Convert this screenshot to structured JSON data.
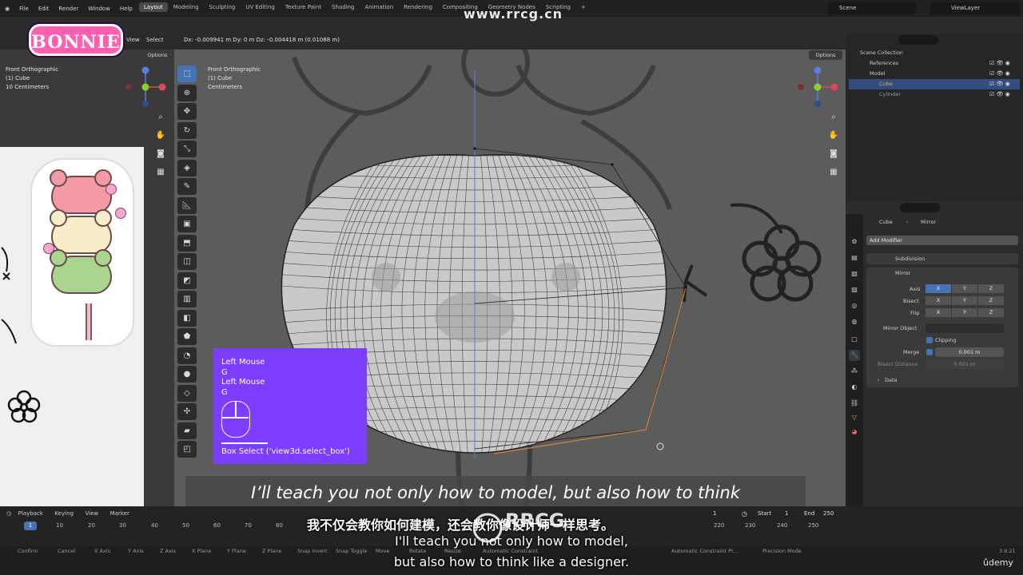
{
  "menubar": {
    "items": [
      "File",
      "Edit",
      "Render",
      "Window",
      "Help"
    ],
    "workspaces": [
      "Layout",
      "Modeling",
      "Sculpting",
      "UV Editing",
      "Texture Paint",
      "Shading",
      "Animation",
      "Rendering",
      "Compositing",
      "Geometry Nodes",
      "Scripting",
      "+"
    ],
    "active_workspace": "Layout",
    "scene": "Scene",
    "view_layer": "ViewLayer"
  },
  "branding": {
    "logo": "BONNIE",
    "watermark_top": "www.rrcg.cn",
    "watermark_text": "RRCG",
    "udemy": "ûdemy"
  },
  "header": {
    "view_label": "View",
    "select_label": "Select",
    "options_label": "Options",
    "readout": "Dx: -0.009941 m  Dy: 0 m  Dz: -0.004418 m (0.01088 m)"
  },
  "left_viewport": {
    "view": "Front Orthographic",
    "object": "(1) Cube",
    "scale": "10 Centimeters"
  },
  "main_viewport": {
    "view": "Front Orthographic",
    "object": "(1) Cube",
    "scale": "Centimeters",
    "options": "Options"
  },
  "keycast": {
    "lines": [
      "Left Mouse",
      "G",
      "Left Mouse",
      "G"
    ],
    "operator": "Box Select ('view3d.select_box')"
  },
  "subtitle_en": "I’ll teach you not only how to model, but also how to think",
  "subtitle_zh": "我不仅会教你如何建模，还会教你像设计师一样思考。",
  "subtitle_en2": [
    "I'll teach you not only how to model,",
    "but also how to think like a designer."
  ],
  "outliner": {
    "root": "Scene Collection",
    "items": [
      {
        "label": "References",
        "depth": 1
      },
      {
        "label": "Model",
        "depth": 1
      },
      {
        "label": "Cube",
        "depth": 2,
        "selected": true
      },
      {
        "label": "Cylinder",
        "depth": 2
      }
    ]
  },
  "properties": {
    "breadcrumb": [
      "Cube",
      "Mirror"
    ],
    "add_modifier": "Add Modifier",
    "modifiers": [
      {
        "name": "Subdivision",
        "expanded": false
      },
      {
        "name": "Mirror",
        "expanded": true
      }
    ],
    "mirror": {
      "axis_label": "Axis",
      "bisect_label": "Bisect",
      "flip_label": "Flip",
      "axes": [
        "X",
        "Y",
        "Z"
      ],
      "axis_on": "X",
      "mirror_object_label": "Mirror Object",
      "clipping_label": "Clipping",
      "merge_label": "Merge",
      "merge_value": "0.001 m",
      "bisect_distance_label": "Bisect Distance",
      "bisect_distance_value": "0.001 m",
      "data_label": "Data"
    }
  },
  "timeline": {
    "menus": [
      "Playback",
      "Keying",
      "View",
      "Marker"
    ],
    "current_frame": "1",
    "ticks": [
      "10",
      "20",
      "30",
      "40",
      "50",
      "60",
      "70",
      "80",
      "220",
      "230",
      "240",
      "250"
    ],
    "frame_field": "1",
    "start_label": "Start",
    "start_value": "1",
    "end_label": "End",
    "end_value": "250"
  },
  "statusbar": {
    "items": [
      "Confirm",
      "Cancel",
      "X Axis",
      "Y Axis",
      "Z Axis",
      "X Plane",
      "Y Plane",
      "Z Plane",
      "Snap Invert",
      "Snap Toggle",
      "Move",
      "Rotate",
      "Resize",
      "Automatic Constraint",
      "Automatic Constraint Pl...",
      "Precision Mode"
    ],
    "version": "3.6.21"
  },
  "colors": {
    "accent": "#4772b3",
    "keycast_bg": "#7d3dff",
    "viewport_bg": "#5c5c5c",
    "logo": "#ff5fae"
  },
  "icons": [
    "blender-icon",
    "cursor-icon",
    "move-icon",
    "rotate-icon",
    "scale-icon",
    "transform-icon",
    "annotate-icon",
    "measure-icon",
    "add-cube-icon",
    "extrude-icon",
    "inset-icon",
    "bevel-icon",
    "loopcut-icon",
    "knife-icon",
    "polybuild-icon",
    "spin-icon",
    "smooth-icon",
    "edge-slide-icon",
    "shrink-icon",
    "shear-icon",
    "rip-icon",
    "zoom-icon",
    "hand-icon",
    "camera-icon",
    "grid-icon",
    "eye-icon",
    "wrench-icon"
  ]
}
